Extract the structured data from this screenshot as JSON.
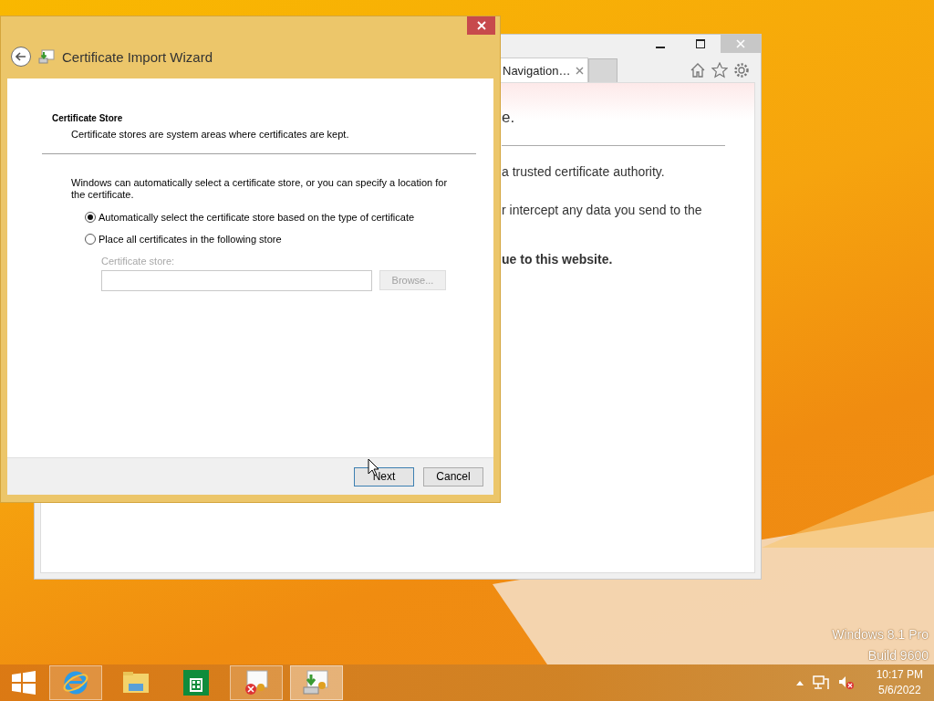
{
  "desktop": {
    "watermark": [
      "Windows 8.1 Pro",
      "Build 9600"
    ]
  },
  "browser": {
    "tabs": [
      {
        "label": "Navigation…",
        "selected": true
      }
    ],
    "lines": [
      {
        "kind": "heading",
        "text": "e."
      },
      {
        "kind": "text",
        "text": "a trusted certificate authority."
      },
      {
        "kind": "text",
        "text": "r intercept any data you send to the"
      },
      {
        "kind": "bold",
        "text": "ue to this website."
      }
    ]
  },
  "dialog": {
    "title": "Certificate Import Wizard",
    "section_title": "Certificate Store",
    "section_subtitle": "Certificate stores are system areas where certificates are kept.",
    "intro": "Windows can automatically select a certificate store, or you can specify a location for the certificate.",
    "options": [
      {
        "label": "Automatically select the certificate store based on the type of certificate",
        "selected": true
      },
      {
        "label": "Place all certificates in the following store",
        "selected": false
      }
    ],
    "store_field": {
      "label": "Certificate store:",
      "disabled": true
    },
    "browse_button": {
      "label": "Browse...",
      "disabled": true
    },
    "buttons": [
      {
        "label": "Next",
        "default": true
      },
      {
        "label": "Cancel",
        "default": false
      }
    ]
  },
  "taskbar": {
    "apps": [
      {
        "kind": "ie",
        "running": true,
        "active": false
      },
      {
        "kind": "explorer",
        "running": false,
        "active": false
      },
      {
        "kind": "store",
        "running": false,
        "active": false
      },
      {
        "kind": "certificate",
        "running": true,
        "active": false
      },
      {
        "kind": "wizard",
        "running": true,
        "active": true
      }
    ],
    "clock": {
      "time": "10:17 PM",
      "date": "5/6/2022"
    }
  }
}
